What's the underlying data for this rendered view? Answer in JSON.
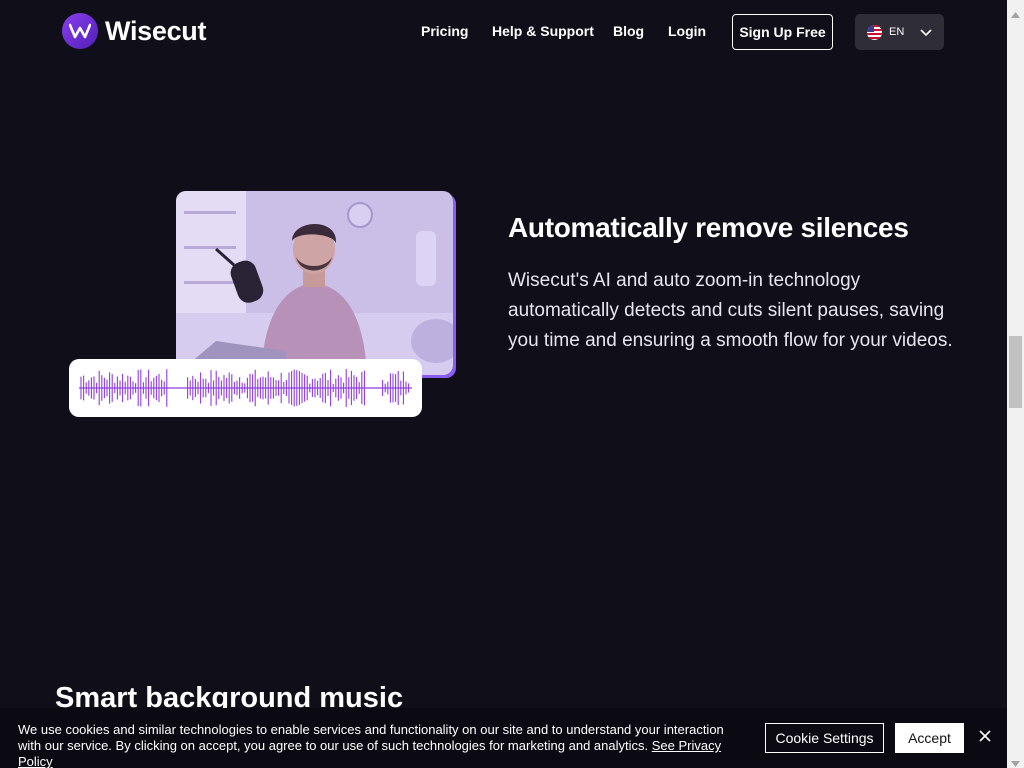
{
  "header": {
    "brand": "Wisecut",
    "nav": [
      "Pricing",
      "Help & Support",
      "Blog",
      "Login"
    ],
    "signup_label": "Sign Up Free",
    "language": "EN"
  },
  "feature": {
    "heading": "Automatically remove silences",
    "description": "Wisecut's AI and auto zoom-in technology automatically detects and cuts silent pauses, saving you time and ensuring a smooth flow for your videos."
  },
  "next_section": {
    "heading": "Smart background music"
  },
  "cookie": {
    "text": "We use cookies and similar technologies to enable services and functionality on our site and to understand your interaction with our service. By clicking on accept, you agree to our use of such technologies for marketing and analytics.",
    "link": "See Privacy Policy",
    "settings_label": "Cookie Settings",
    "accept_label": "Accept"
  },
  "colors": {
    "background": "#0f0e19",
    "accent": "#8a5cf0",
    "waveform": "#8e3fdc"
  },
  "icons": [
    "wisecut-logo-icon",
    "us-flag-icon",
    "chevron-down-icon",
    "close-icon"
  ]
}
